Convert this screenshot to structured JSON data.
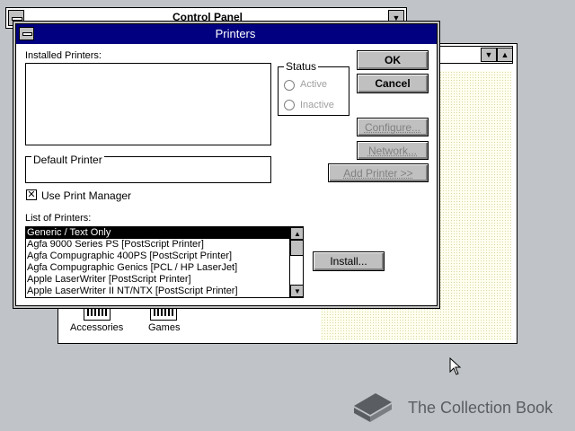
{
  "control_panel": {
    "title": "Control Panel"
  },
  "main_window": {
    "icons": [
      {
        "label": "Accessories"
      },
      {
        "label": "Games"
      }
    ]
  },
  "dialog": {
    "title": "Printers",
    "installed_printers_label": "Installed Printers:",
    "status_label": "Status",
    "status_active": "Active",
    "status_inactive": "Inactive",
    "default_printer_label": "Default Printer",
    "default_printer_value": "",
    "use_print_manager_label": "Use Print Manager",
    "use_print_manager_checked": true,
    "list_of_printers_label": "List of Printers:",
    "printers": [
      "Generic / Text Only",
      "Agfa 9000 Series PS [PostScript Printer]",
      "Agfa Compugraphic 400PS [PostScript Printer]",
      "Agfa Compugraphic Genics [PCL / HP LaserJet]",
      "Apple LaserWriter [PostScript Printer]",
      "Apple LaserWriter II NT/NTX [PostScript Printer]"
    ],
    "selected_printer_index": 0,
    "buttons": {
      "ok": "OK",
      "cancel": "Cancel",
      "configure": "Configure...",
      "network": "Network...",
      "add_printer": "Add Printer >>",
      "install": "Install..."
    }
  },
  "watermark": {
    "text": "The Collection Book"
  }
}
